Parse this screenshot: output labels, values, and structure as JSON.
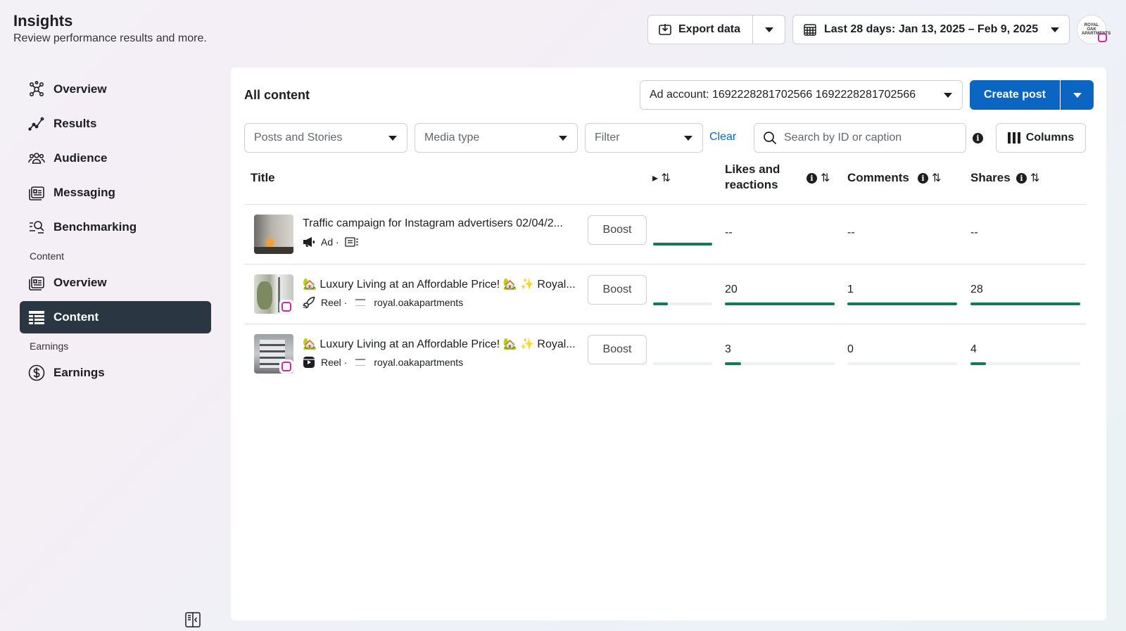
{
  "header": {
    "title": "Insights",
    "subtitle": "Review performance results and more.",
    "export_label": "Export data",
    "date_range": "Last 28 days: Jan 13, 2025 – Feb 9, 2025",
    "avatar_text": "ROYAL OAK APARTMENTS"
  },
  "sidebar": {
    "items": [
      {
        "label": "Overview",
        "icon": "network-icon"
      },
      {
        "label": "Results",
        "icon": "trend-icon"
      },
      {
        "label": "Audience",
        "icon": "people-icon"
      },
      {
        "label": "Messaging",
        "icon": "messaging-icon"
      },
      {
        "label": "Benchmarking",
        "icon": "benchmark-icon"
      }
    ],
    "content_section": "Content",
    "content_items": [
      {
        "label": "Overview",
        "icon": "overview-icon"
      },
      {
        "label": "Content",
        "icon": "table-icon",
        "active": true
      }
    ],
    "earnings_section": "Earnings",
    "earnings_items": [
      {
        "label": "Earnings",
        "icon": "dollar-icon"
      }
    ]
  },
  "panel": {
    "title": "All content",
    "ad_account": "Ad account: 1692228281702566 1692228281702566",
    "create_post": "Create post",
    "filters": {
      "posts": "Posts and Stories",
      "media": "Media type",
      "filter": "Filter",
      "clear": "Clear",
      "search_placeholder": "Search by ID or caption",
      "columns": "Columns"
    },
    "table": {
      "headers": {
        "title": "Title",
        "likes_line1": "Likes and",
        "likes_line2": "reactions",
        "comments": "Comments",
        "shares": "Shares"
      },
      "boost_label": "Boost",
      "rows": [
        {
          "title": "Traffic campaign for Instagram advertisers 02/04/2...",
          "type": "Ad ·",
          "account": "",
          "reach_fill": 1.0,
          "likes": "--",
          "likes_fill": null,
          "comments": "--",
          "comments_fill": null,
          "shares": "--",
          "shares_fill": null
        },
        {
          "title": "🏡 Luxury Living at an Affordable Price! 🏡 ✨ Royal...",
          "type": "Reel ·",
          "account": "royal.oakapartments",
          "reach_fill": 0.25,
          "likes": "20",
          "likes_fill": 1.0,
          "comments": "1",
          "comments_fill": 1.0,
          "shares": "28",
          "shares_fill": 1.0
        },
        {
          "title": "🏡 Luxury Living at an Affordable Price! 🏡 ✨ Royal...",
          "type": "Reel ·",
          "account": "royal.oakapartments",
          "reach_fill": 0.0,
          "likes": "3",
          "likes_fill": 0.15,
          "comments": "0",
          "comments_fill": 0.0,
          "shares": "4",
          "shares_fill": 0.14
        }
      ]
    }
  },
  "colors": {
    "accent": "#0a66c2",
    "active_nav": "#2a3642",
    "bar_fill": "#137a55"
  }
}
